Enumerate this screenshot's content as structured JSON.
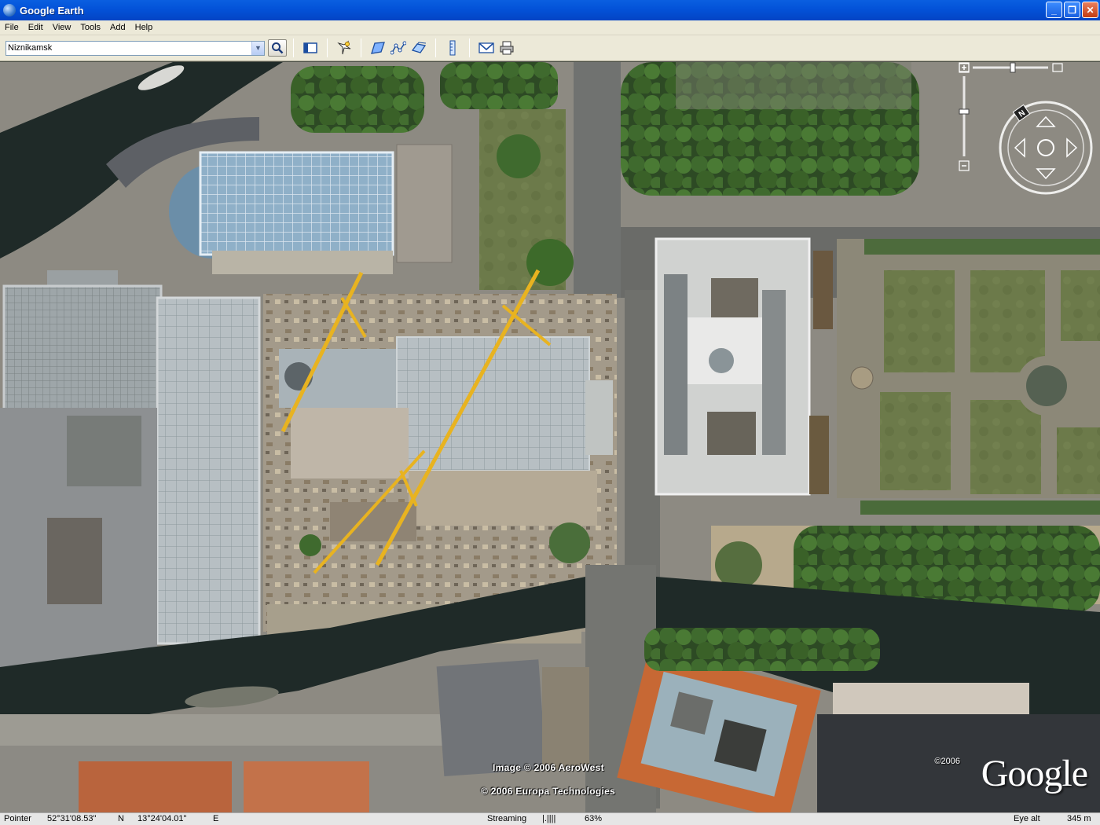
{
  "window": {
    "title": "Google Earth"
  },
  "menu": {
    "items": [
      "File",
      "Edit",
      "View",
      "Tools",
      "Add",
      "Help"
    ]
  },
  "toolbar": {
    "search_value": "Niznikamsk",
    "icons": [
      "sidebar-icon",
      "placemark-icon",
      "polygon-icon",
      "path-icon",
      "image-overlay-icon",
      "ruler-icon",
      "email-icon",
      "print-icon"
    ]
  },
  "map": {
    "attribution_image": "Image © 2006 AeroWest",
    "attribution_europa": "© 2006 Europa Technologies",
    "logo_year": "©2006",
    "logo_text": "Google"
  },
  "status": {
    "pointer_label": "Pointer",
    "lat": "52°31'08.53\"",
    "lat_dir": "N",
    "lon": "13°24'04.01\"",
    "lon_dir": "E",
    "streaming_label": "Streaming",
    "streaming_bar": "|.||||",
    "streaming_percent": "63%",
    "eye_alt_label": "Eye alt",
    "eye_alt_value": "345 m"
  },
  "colors": {
    "titlebar": "#0352d8",
    "chrome": "#ece9d8",
    "river": "#1f2a28",
    "grass": "#4f6b3a"
  }
}
